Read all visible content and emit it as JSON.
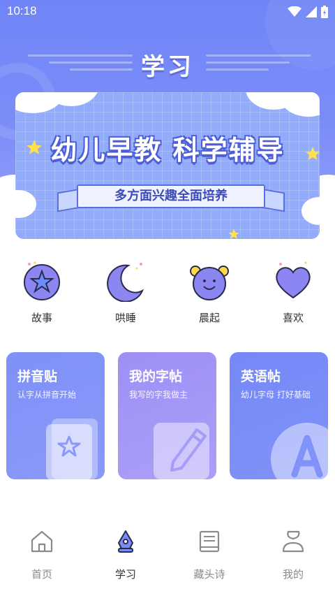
{
  "status_bar": {
    "time": "10:18"
  },
  "header": {
    "title": "学习"
  },
  "banner": {
    "headline": "幼儿早教 科学辅导",
    "ribbon": "多方面兴趣全面培养"
  },
  "categories": [
    {
      "label": "故事",
      "icon": "star-icon"
    },
    {
      "label": "哄睡",
      "icon": "moon-icon"
    },
    {
      "label": "晨起",
      "icon": "smiley-icon"
    },
    {
      "label": "喜欢",
      "icon": "heart-icon"
    }
  ],
  "cards": [
    {
      "title": "拼音贴",
      "subtitle": "认字从拼音开始",
      "icon": "book-icon"
    },
    {
      "title": "我的字帖",
      "subtitle": "我写的字我做主",
      "icon": "pencil-icon"
    },
    {
      "title": "英语帖",
      "subtitle": "幼儿字母 打好基础",
      "icon": "letter-a-icon"
    }
  ],
  "tabbar": [
    {
      "label": "首页",
      "icon": "home-icon",
      "active": false
    },
    {
      "label": "学习",
      "icon": "pen-nib-icon",
      "active": true
    },
    {
      "label": "藏头诗",
      "icon": "poem-book-icon",
      "active": false
    },
    {
      "label": "我的",
      "icon": "user-icon",
      "active": false
    }
  ],
  "colors": {
    "primary": "#6f85f7",
    "card_pinyin": "#8293f8",
    "card_copybook": "#a799f7",
    "card_english": "#7a8cf7",
    "icon_fill": "#8c86f2",
    "icon_yellow": "#ffd84a"
  }
}
